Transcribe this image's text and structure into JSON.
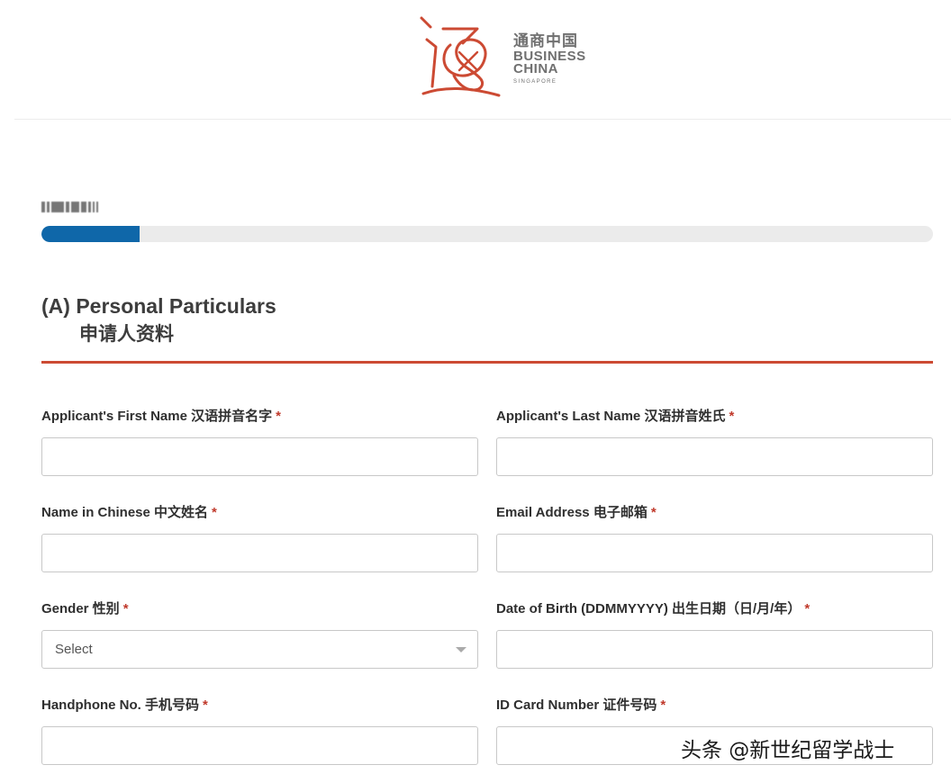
{
  "brand": {
    "name_cn": "通商中国",
    "name_en_line1": "BUSINESS",
    "name_en_line2": "CHINA",
    "name_en_sub": "SINGAPORE",
    "accent_color": "#cc4a33",
    "text_color": "#707070"
  },
  "progress": {
    "fill_fraction": 0.11,
    "fill_color": "#0f67a9"
  },
  "section": {
    "title": "(A) Personal Particulars",
    "title_cn": "申请人资料"
  },
  "form": {
    "required_marker": "*",
    "first_name": {
      "label": "Applicant's First Name 汉语拼音名字",
      "value": ""
    },
    "last_name": {
      "label": "Applicant's Last Name 汉语拼音姓氏",
      "value": ""
    },
    "chinese_name": {
      "label": "Name in Chinese 中文姓名",
      "value": ""
    },
    "email": {
      "label": "Email Address 电子邮箱",
      "value": ""
    },
    "gender": {
      "label": "Gender 性别",
      "selected": "Select"
    },
    "dob": {
      "label": "Date of Birth (DDMMYYYY) 出生日期（日/月/年）",
      "value": ""
    },
    "handphone": {
      "label": "Handphone No. 手机号码",
      "value": ""
    },
    "id_card": {
      "label": "ID Card Number 证件号码",
      "value": ""
    }
  },
  "watermark": {
    "text": "头条 @新世纪留学战士"
  }
}
